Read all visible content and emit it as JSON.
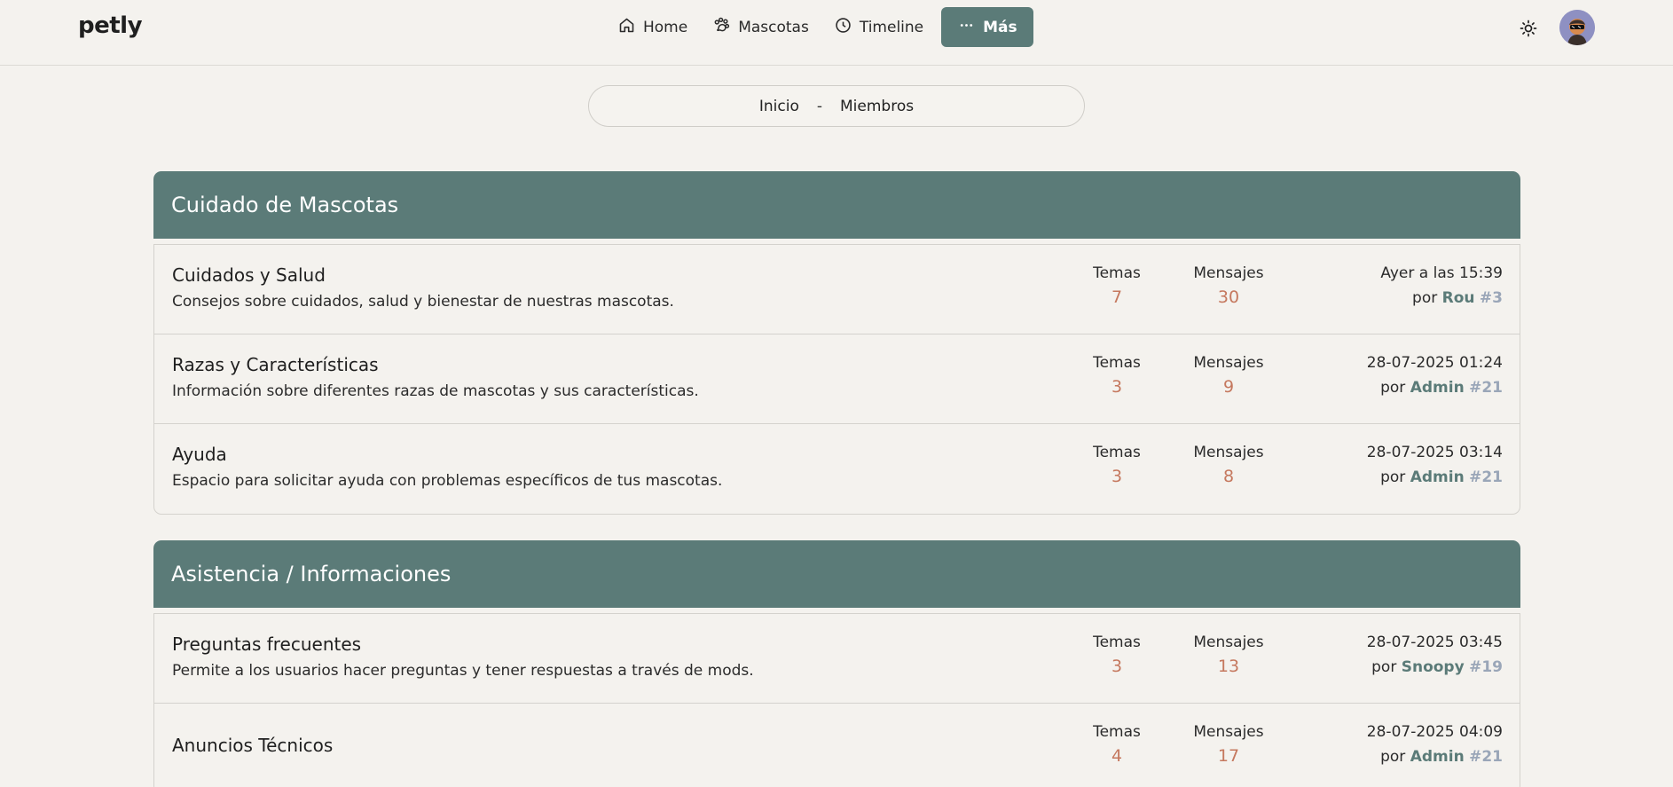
{
  "brand": "petly",
  "nav": {
    "home": "Home",
    "mascotas": "Mascotas",
    "timeline": "Timeline",
    "mas": "Más"
  },
  "breadcrumb": {
    "home": "Inicio",
    "separator": "-",
    "current": "Miembros"
  },
  "colors": {
    "accent": "#5b7b78",
    "count": "#c5785e",
    "user_id": "#9aa6b8",
    "background": "#f4f2ee"
  },
  "categories": [
    {
      "title": "Cuidado de Mascotas",
      "forums": [
        {
          "title": "Cuidados y Salud",
          "description": "Consejos sobre cuidados, salud y bienestar de nuestras mascotas.",
          "temas_label": "Temas",
          "temas": "7",
          "mensajes_label": "Mensajes",
          "mensajes": "30",
          "last_date": "Ayer a las 15:39",
          "by": "por",
          "user": "Rou",
          "user_id": "#3"
        },
        {
          "title": "Razas y Características",
          "description": "Información sobre diferentes razas de mascotas y sus características.",
          "temas_label": "Temas",
          "temas": "3",
          "mensajes_label": "Mensajes",
          "mensajes": "9",
          "last_date": "28-07-2025 01:24",
          "by": "por",
          "user": "Admin",
          "user_id": "#21"
        },
        {
          "title": "Ayuda",
          "description": "Espacio para solicitar ayuda con problemas específicos de tus mascotas.",
          "temas_label": "Temas",
          "temas": "3",
          "mensajes_label": "Mensajes",
          "mensajes": "8",
          "last_date": "28-07-2025 03:14",
          "by": "por",
          "user": "Admin",
          "user_id": "#21"
        }
      ]
    },
    {
      "title": "Asistencia / Informaciones",
      "forums": [
        {
          "title": "Preguntas frecuentes",
          "description": "Permite a los usuarios hacer preguntas y tener respuestas a través de mods.",
          "temas_label": "Temas",
          "temas": "3",
          "mensajes_label": "Mensajes",
          "mensajes": "13",
          "last_date": "28-07-2025 03:45",
          "by": "por",
          "user": "Snoopy",
          "user_id": "#19"
        },
        {
          "title": "Anuncios Técnicos",
          "description": "",
          "temas_label": "Temas",
          "temas": "4",
          "mensajes_label": "Mensajes",
          "mensajes": "17",
          "last_date": "28-07-2025 04:09",
          "by": "por",
          "user": "Admin",
          "user_id": "#21"
        }
      ]
    }
  ]
}
